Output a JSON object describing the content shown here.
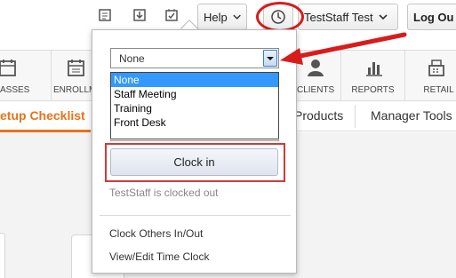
{
  "topbar": {
    "help_label": "Help",
    "user_label": "TestStaff Test",
    "logout_label": "Log Ou",
    "icons": [
      "notes-icon",
      "download-icon",
      "checklist-icon",
      "clock-icon"
    ]
  },
  "nav": {
    "items": [
      {
        "label": "ASSES",
        "icon": "calendar-icon"
      },
      {
        "label": "ENROLLME",
        "icon": "calendar-icon"
      },
      {
        "label": "CLIENTS",
        "icon": "person-icon"
      },
      {
        "label": "REPORTS",
        "icon": "bar-chart-icon"
      },
      {
        "label": "RETAIL",
        "icon": "register-icon"
      }
    ]
  },
  "subnav": {
    "active": "etup Checklist",
    "items": [
      "Products",
      "Manager Tools"
    ]
  },
  "clock_popup": {
    "selected": "None",
    "options": [
      "None",
      "Staff Meeting",
      "Training",
      "Front Desk"
    ],
    "clock_in_label": "Clock in",
    "status": "TestStaff is clocked out",
    "links": [
      "Clock Others In/Out",
      "View/Edit Time Clock"
    ]
  },
  "colors": {
    "accent": "#e8731a",
    "highlight_red": "#d81c1c",
    "selection_blue": "#3399ff"
  }
}
